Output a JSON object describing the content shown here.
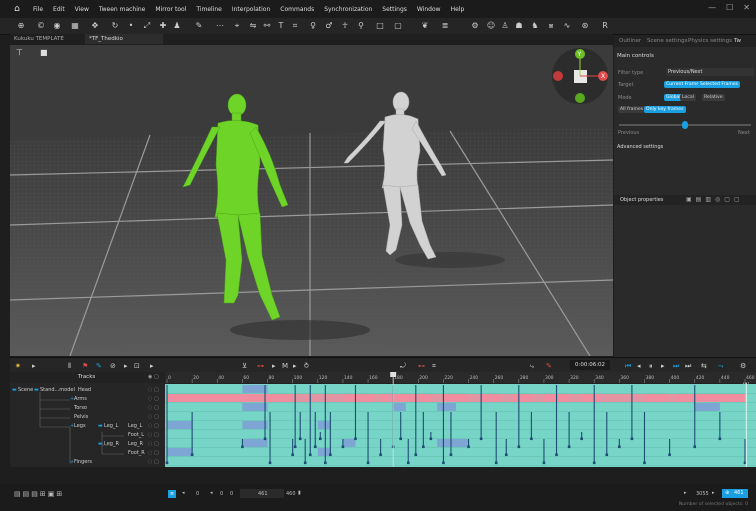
{
  "menu": {
    "items": [
      "File",
      "Edit",
      "View",
      "Tween machine",
      "Mirror tool",
      "Timeline",
      "Interpolation",
      "Commands",
      "Synchronization",
      "Settings",
      "Window",
      "Help"
    ]
  },
  "tabs": [
    {
      "label": "Kukuku TEMPLATE"
    },
    {
      "label": "*TF_Thedkio"
    }
  ],
  "right_panel": {
    "tabs": [
      "Outliner",
      "Scene settings",
      "Physics settings",
      "Tw"
    ],
    "main_controls": "Main controls",
    "filter_type_label": "Filter type",
    "filter_type_value": "Previous/Next",
    "target_label": "Target",
    "target_current": "Current Frame",
    "target_selected": "Selected Frames",
    "mode_label": "Mode",
    "mode_global": "Global",
    "mode_local": "Local",
    "mode_relative": "Relative",
    "all_frames": "All frames",
    "only_key_frames": "Only key frames",
    "slider_fraction": 0.5,
    "previous_label": "Previous",
    "next_label": "Next",
    "advanced_settings": "Advanced settings",
    "object_properties": "Object properties"
  },
  "controls": {
    "time": "0:00:06:02"
  },
  "tracks": {
    "header": "Tracks",
    "rows": [
      {
        "scene": "Scene",
        "model": "Stand...model",
        "name": "Head"
      },
      {
        "name": "Arms"
      },
      {
        "name": "Torso"
      },
      {
        "name": "Pelvis"
      },
      {
        "name": "Legs",
        "sub": "Leg_L",
        "subsub": "Leg_L"
      },
      {
        "subsub": "Foot_L"
      },
      {
        "sub": "Leg_R",
        "subsub": "Leg_R"
      },
      {
        "subsub": "Foot_R"
      },
      {
        "name": "Fingers"
      }
    ]
  },
  "ruler": {
    "ticks": [
      "0",
      "20",
      "40",
      "60",
      "80",
      "100",
      "120",
      "140",
      "160",
      "180",
      "200",
      "220",
      "240",
      "260",
      "280",
      "300",
      "320",
      "340",
      "360",
      "380",
      "400",
      "420",
      "440",
      "460"
    ],
    "end": "461"
  },
  "status": {
    "frame_start": "0",
    "frame_a": "0",
    "frame_b": "0",
    "frame_end": "461",
    "frame_total": "460",
    "fps_value": "3055",
    "zoom_value": "461",
    "selected_objects": "Number of selected objects: 0"
  },
  "colors": {
    "accent": "#1a9fe0",
    "green_figure": "#6fd428",
    "gray_figure": "#d2d2d2",
    "track_teal": "#76d5c6",
    "track_pink": "#f08ea0",
    "track_blue": "#7ea6d4",
    "key_line": "#1c4c73"
  }
}
